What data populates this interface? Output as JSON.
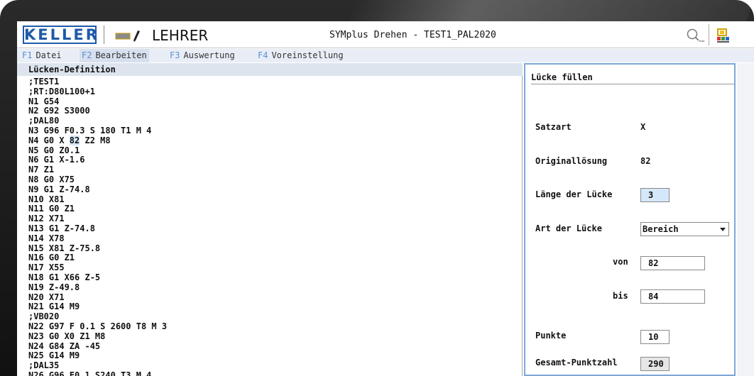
{
  "titlebar": {
    "logo": "KELLER",
    "role": "LEHRER",
    "app_title": "SYMplus Drehen - TEST1_PAL2020"
  },
  "icons": {
    "pencil": "pencil-icon",
    "search": "search-icon",
    "tool": "tool-icon"
  },
  "menu": [
    {
      "key": "F1",
      "label": "Datei"
    },
    {
      "key": "F2",
      "label": "Bearbeiten"
    },
    {
      "key": "F3",
      "label": "Auswertung"
    },
    {
      "key": "F4",
      "label": "Voreinstellung"
    }
  ],
  "code_panel": {
    "title": "Lücken-Definition",
    "lines": [
      ";TEST1",
      ";RT:D80L100+1",
      "N1 G54",
      "N2 G92 S3000",
      ";DAL80",
      "N3 G96 F0.3 S 180 T1 M 4",
      "N4 G0 X 82 Z2 M8",
      "N5 G0 Z0.1",
      "N6 G1 X-1.6",
      "N7 Z1",
      "N8 G0 X75",
      "N9 G1 Z-74.8",
      "N10 X81",
      "N11 G0 Z1",
      "N12 X71",
      "N13 G1 Z-74.8",
      "N14 X78",
      "N15 X81 Z-75.8",
      "N16 G0 Z1",
      "N17 X55",
      "N18 G1 X66 Z-5",
      "N19 Z-49.8",
      "N20 X71",
      "N21 G14 M9",
      ";VB020",
      "N22 G97 F 0.1 S 2600 T8 M 3",
      "N23 G0 X0 Z1 M8",
      "N24 G84 ZA -45",
      "N25 G14 M9",
      ";DAL35",
      "N26 G96 F0.1 S240 T3 M 4"
    ]
  },
  "form": {
    "title": "Lücke füllen",
    "satzart_label": "Satzart",
    "satzart_value": "X",
    "original_label": "Originallösung",
    "original_value": "82",
    "laenge_label": "Länge der Lücke",
    "laenge_value": "3",
    "art_label": "Art der Lücke",
    "art_value": "Bereich",
    "von_label": "von",
    "von_value": "82",
    "bis_label": "bis",
    "bis_value": "84",
    "punkte_label": "Punkte",
    "punkte_value": "10",
    "gesamt_label": "Gesamt-Punktzahl",
    "gesamt_value": "290"
  },
  "colors": {
    "brand_blue": "#1e5aa8",
    "fkey_blue": "#5e8dd6",
    "focus_fill": "#d4e8fa",
    "panel_border": "#7fa7d8"
  }
}
